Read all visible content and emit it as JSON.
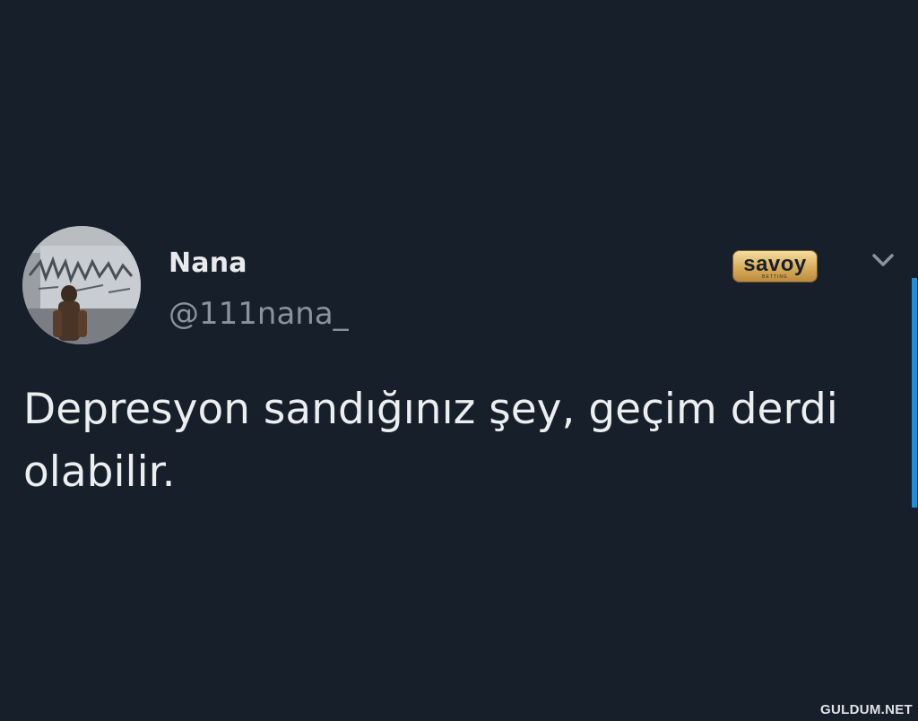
{
  "tweet": {
    "display_name": "Nana",
    "handle": "@111nana_",
    "text": "Depresyon sandığınız şey, geçim derdi olabilir."
  },
  "badge": {
    "brand": "savoy",
    "subtitle": "BETTING"
  },
  "watermark": {
    "text": "GULDUM.NET"
  },
  "icons": {
    "avatar": "profile-photo",
    "menu": "chevron-down-icon"
  },
  "colors": {
    "background": "#171f2a",
    "text_primary": "#eceef0",
    "text_secondary": "#8a939d",
    "accent": "#1c8fd6",
    "badge_gold": "#d9ad5b"
  }
}
